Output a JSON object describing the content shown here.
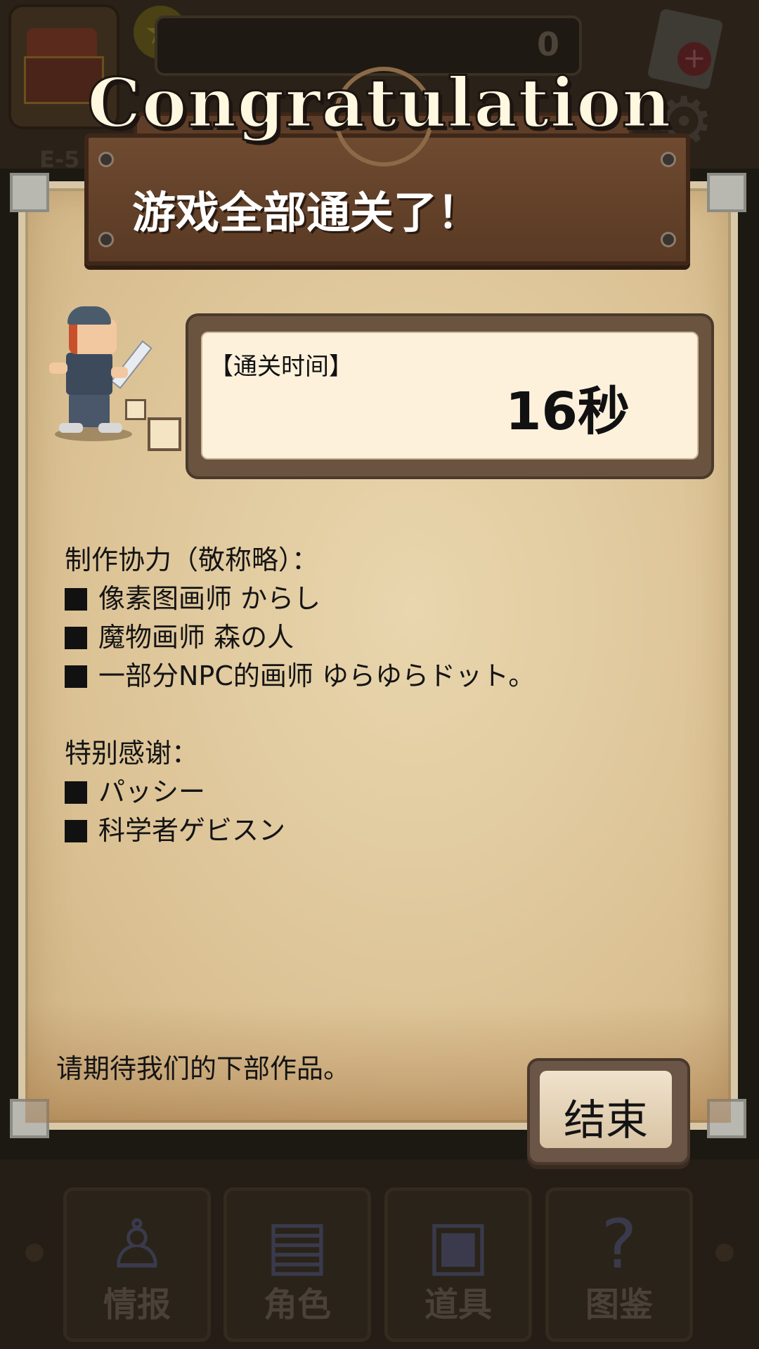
{
  "hud": {
    "score": "0",
    "floor": "E-5",
    "nav": [
      {
        "label": "情报"
      },
      {
        "label": "角色"
      },
      {
        "label": "道具"
      },
      {
        "label": "图鉴"
      }
    ]
  },
  "dialog": {
    "banner": "Congratulation",
    "message": "游戏全部通关了！",
    "time_label": "【通关时间】",
    "time_value": "16秒",
    "credits_heading": "制作协力（敬称略）：",
    "credits": [
      "像素图画师 からし",
      "魔物画师 森の人",
      "一部分NPC的画师 ゆらゆらドット。"
    ],
    "thanks_heading": "特别感谢：",
    "thanks": [
      "パッシー",
      "科学者ゲビスン"
    ],
    "closing": "请期待我们的下部作品。",
    "end_button": "结束"
  },
  "colors": {
    "board": "#5a3a24",
    "parchment": "#e9d6ae",
    "time_panel": "#fdf1dc"
  }
}
